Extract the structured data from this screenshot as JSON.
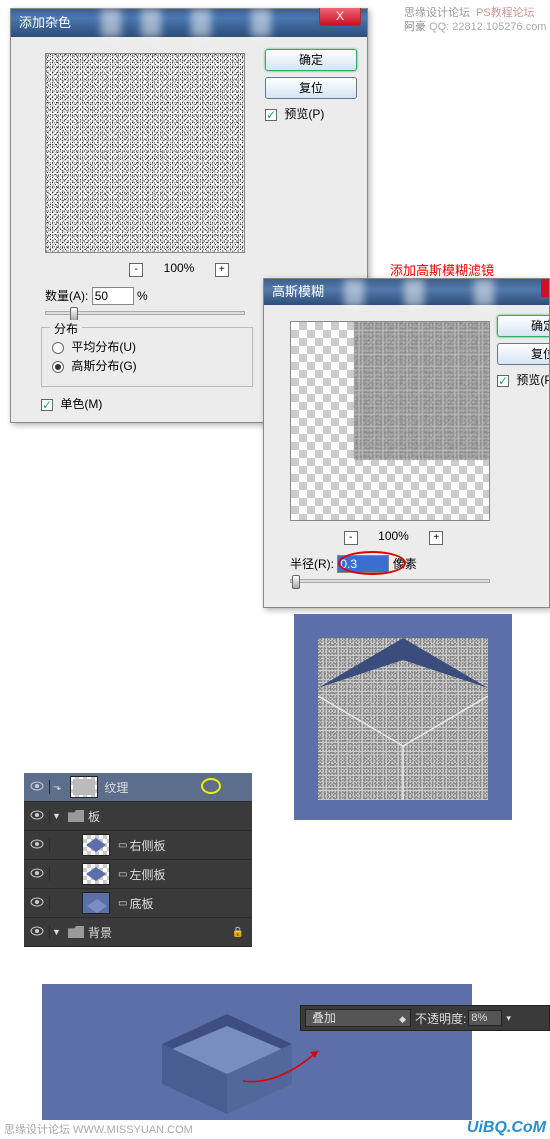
{
  "watermark": {
    "line1": "思缘设计论坛",
    "line1b": "PS教程论坛",
    "line2a": "阿豪",
    "line2b": "QQ: 22812.105276.com"
  },
  "dialog_noise": {
    "title": "添加杂色",
    "zoom": "100%",
    "amount_label": "数量(A):",
    "amount_value": "50",
    "amount_unit": "%",
    "group_label": "分布",
    "radio_uniform": "平均分布(U)",
    "radio_gaussian": "高斯分布(G)",
    "check_mono": "单色(M)",
    "btn_ok": "确定",
    "btn_reset": "复位",
    "check_preview": "预览(P)",
    "close": "X"
  },
  "annotation1": "添加高斯模糊滤镜",
  "dialog_blur": {
    "title": "高斯模糊",
    "zoom": "100%",
    "radius_label": "半径(R):",
    "radius_value": "0.3",
    "radius_unit": "像素",
    "btn_ok": "确定",
    "btn_reset": "复位",
    "check_preview": "预览(P"
  },
  "layers": {
    "items": [
      {
        "name": "纹理"
      },
      {
        "name": "板"
      },
      {
        "name": "右侧板"
      },
      {
        "name": "左侧板"
      },
      {
        "name": "底板"
      },
      {
        "name": "背景"
      }
    ]
  },
  "optbar": {
    "blend": "叠加",
    "opacity_label": "不透明度:",
    "opacity_value": "8%"
  },
  "zoom_minus": "-",
  "zoom_plus": "+",
  "footer": {
    "left": "思缘设计论坛  WWW.MISSYUAN.COM",
    "right": "UiBQ.CoM"
  }
}
